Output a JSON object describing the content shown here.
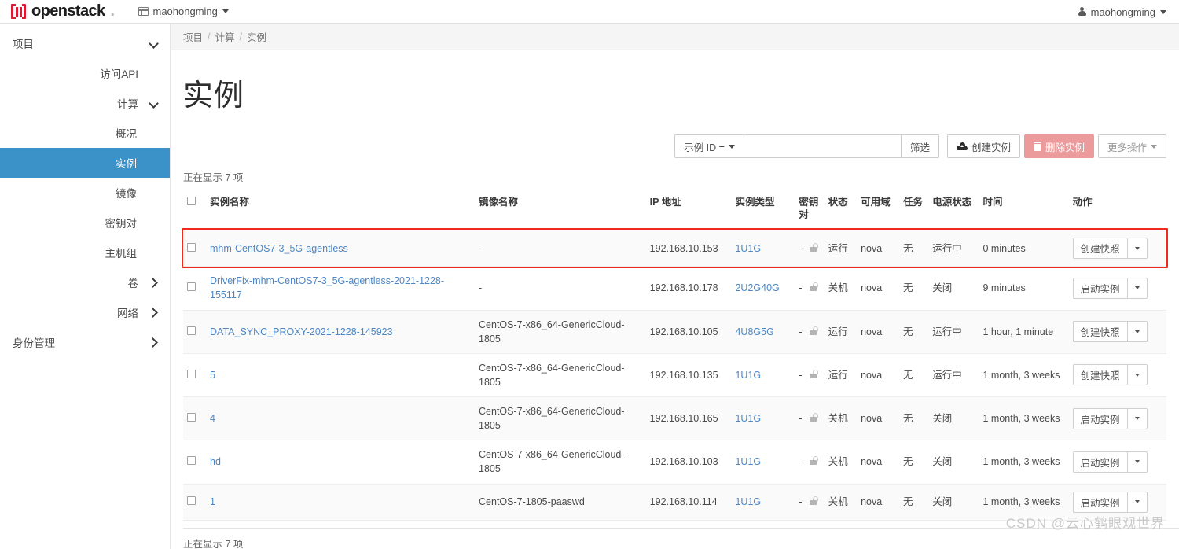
{
  "topbar": {
    "brand": "openstack",
    "brand_dot": ".",
    "project_switcher": "maohongming",
    "user": "maohongming"
  },
  "sidebar": {
    "items": [
      {
        "label": "项目",
        "level": 0,
        "chevron": "down",
        "active": false
      },
      {
        "label": "访问API",
        "level": 1,
        "chevron": "none",
        "active": false
      },
      {
        "label": "计算",
        "level": 1,
        "chevron": "down",
        "active": false
      },
      {
        "label": "概况",
        "level": 2,
        "chevron": "none",
        "active": false
      },
      {
        "label": "实例",
        "level": 2,
        "chevron": "none",
        "active": true
      },
      {
        "label": "镜像",
        "level": 2,
        "chevron": "none",
        "active": false
      },
      {
        "label": "密钥对",
        "level": 2,
        "chevron": "none",
        "active": false
      },
      {
        "label": "主机组",
        "level": 2,
        "chevron": "none",
        "active": false
      },
      {
        "label": "卷",
        "level": 1,
        "chevron": "right",
        "active": false
      },
      {
        "label": "网络",
        "level": 1,
        "chevron": "right",
        "active": false
      },
      {
        "label": "身份管理",
        "level": 0,
        "chevron": "right",
        "active": false
      }
    ]
  },
  "breadcrumb": {
    "items": [
      "项目",
      "计算",
      "实例"
    ],
    "separator": "/"
  },
  "page": {
    "title": "实例"
  },
  "toolbar": {
    "filter_select": "示例 ID =",
    "search_value": "",
    "search_placeholder": "",
    "filter_button": "筛选",
    "create_button": "创建实例",
    "delete_button": "删除实例",
    "more_button": "更多操作"
  },
  "counts": {
    "top": "正在显示 7 项",
    "bottom": "正在显示 7 项"
  },
  "table": {
    "headers": [
      "实例名称",
      "镜像名称",
      "IP 地址",
      "实例类型",
      "密钥对",
      "状态",
      "可用域",
      "任务",
      "电源状态",
      "时间",
      "动作"
    ],
    "rows": [
      {
        "name": "mhm-CentOS7-3_5G-agentless",
        "image": "-",
        "ip": "192.168.10.153",
        "flavor": "1U1G",
        "keypair": "-",
        "status": "运行",
        "az": "nova",
        "task": "无",
        "power": "运行中",
        "time": "0 minutes",
        "action": "创建快照",
        "highlighted": true
      },
      {
        "name": "DriverFix-mhm-CentOS7-3_5G-agentless-2021-1228-155117",
        "image": "-",
        "ip": "192.168.10.178",
        "flavor": "2U2G40G",
        "keypair": "-",
        "status": "关机",
        "az": "nova",
        "task": "无",
        "power": "关闭",
        "time": "9 minutes",
        "action": "启动实例",
        "highlighted": false
      },
      {
        "name": "DATA_SYNC_PROXY-2021-1228-145923",
        "image": "CentOS-7-x86_64-GenericCloud-1805",
        "ip": "192.168.10.105",
        "flavor": "4U8G5G",
        "keypair": "-",
        "status": "运行",
        "az": "nova",
        "task": "无",
        "power": "运行中",
        "time": "1 hour, 1 minute",
        "action": "创建快照",
        "highlighted": false
      },
      {
        "name": "5",
        "image": "CentOS-7-x86_64-GenericCloud-1805",
        "ip": "192.168.10.135",
        "flavor": "1U1G",
        "keypair": "-",
        "status": "运行",
        "az": "nova",
        "task": "无",
        "power": "运行中",
        "time": "1 month, 3 weeks",
        "action": "创建快照",
        "highlighted": false
      },
      {
        "name": "4",
        "image": "CentOS-7-x86_64-GenericCloud-1805",
        "ip": "192.168.10.165",
        "flavor": "1U1G",
        "keypair": "-",
        "status": "关机",
        "az": "nova",
        "task": "无",
        "power": "关闭",
        "time": "1 month, 3 weeks",
        "action": "启动实例",
        "highlighted": false
      },
      {
        "name": "hd",
        "image": "CentOS-7-x86_64-GenericCloud-1805",
        "ip": "192.168.10.103",
        "flavor": "1U1G",
        "keypair": "-",
        "status": "关机",
        "az": "nova",
        "task": "无",
        "power": "关闭",
        "time": "1 month, 3 weeks",
        "action": "启动实例",
        "highlighted": false
      },
      {
        "name": "1",
        "image": "CentOS-7-1805-paaswd",
        "ip": "192.168.10.114",
        "flavor": "1U1G",
        "keypair": "-",
        "status": "关机",
        "az": "nova",
        "task": "无",
        "power": "关闭",
        "time": "1 month, 3 weeks",
        "action": "启动实例",
        "highlighted": false
      }
    ]
  },
  "watermark": "CSDN @云心鹤眼观世界",
  "colors": {
    "brand_red": "#da1a32",
    "active_blue": "#3b92c9",
    "link_blue": "#4d86c4",
    "danger_red": "#eb9b9b",
    "highlight_border": "#ef2b20"
  }
}
